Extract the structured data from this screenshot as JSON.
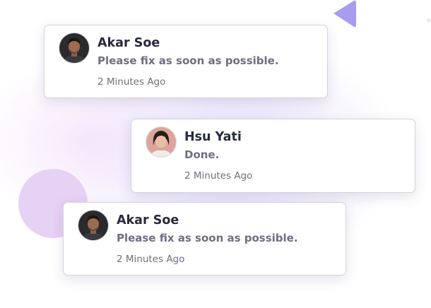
{
  "notifications": [
    {
      "name": "Akar Soe",
      "message": "Please fix as soon as possible.",
      "time": "2 Minutes Ago",
      "avatar_icon": "male-avatar"
    },
    {
      "name": "Hsu Yati",
      "message": "Done.",
      "time": "2 Minutes Ago",
      "avatar_icon": "female-avatar"
    },
    {
      "name": "Akar Soe",
      "message": "Please fix as soon as possible.",
      "time": "2 Minutes Ago",
      "avatar_icon": "male-avatar"
    }
  ],
  "colors": {
    "background": "#ffffff",
    "glow": "#cdbef8",
    "circle": "#e6d2f4",
    "triangle": "#a89cf0",
    "name_text": "#262b3d",
    "secondary_text": "#6c7080",
    "card_border": "#d3d3dc"
  }
}
